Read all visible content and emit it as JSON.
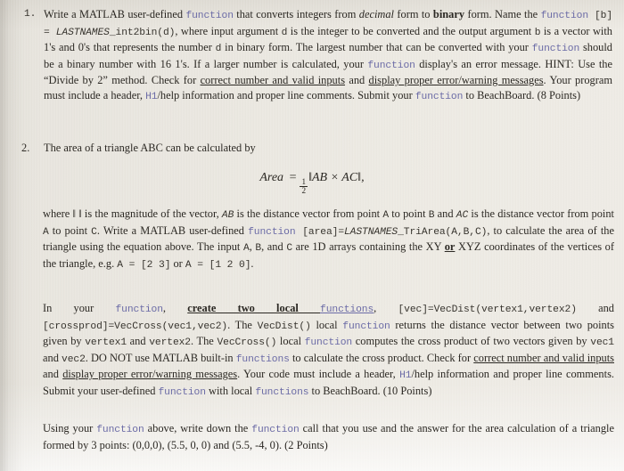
{
  "document": {
    "type": "homework-assignment-scan",
    "paper_color": "#e9e6df",
    "text_color": "#2b2823",
    "code_color": "#6b6ba6"
  },
  "questions": [
    {
      "number": "1.",
      "points": "(8 Points)",
      "segments": [
        {
          "t": "Write a MATLAB user-defined ",
          "s": "plain"
        },
        {
          "t": "function",
          "s": "code"
        },
        {
          "t": " that converts integers from ",
          "s": "plain"
        },
        {
          "t": "decimal",
          "s": "italic"
        },
        {
          "t": " form to ",
          "s": "plain"
        },
        {
          "t": "binary",
          "s": "bold"
        },
        {
          "t": " form. Name the ",
          "s": "plain"
        },
        {
          "t": "function",
          "s": "code"
        },
        {
          "t": " [b] = ",
          "s": "mono-dark"
        },
        {
          "t": "LASTNAMES",
          "s": "mono-ital"
        },
        {
          "t": "_int2bin(d)",
          "s": "mono-dark"
        },
        {
          "t": ", where input argument ",
          "s": "plain"
        },
        {
          "t": "d",
          "s": "mono-dark"
        },
        {
          "t": " is the integer to be converted and the output argument ",
          "s": "plain"
        },
        {
          "t": "b",
          "s": "mono-dark"
        },
        {
          "t": " is a vector with 1's and 0's that represents the number ",
          "s": "plain"
        },
        {
          "t": "d",
          "s": "mono-dark"
        },
        {
          "t": " in binary form. The largest number that can be converted with your ",
          "s": "plain"
        },
        {
          "t": "function",
          "s": "code"
        },
        {
          "t": " should be a binary number with 16 1's.  If a larger number is calculated, your ",
          "s": "plain"
        },
        {
          "t": "function",
          "s": "code"
        },
        {
          "t": " display's an error message. HINT: Use the “Divide by 2” method. Check for ",
          "s": "plain"
        },
        {
          "t": "correct number and valid inputs",
          "s": "underline"
        },
        {
          "t": " and ",
          "s": "plain"
        },
        {
          "t": "display proper error/warning messages",
          "s": "underline"
        },
        {
          "t": ". Your program must include a header, ",
          "s": "plain"
        },
        {
          "t": "H1",
          "s": "code"
        },
        {
          "t": "/help information and proper line comments.  Submit your ",
          "s": "plain"
        },
        {
          "t": "function",
          "s": "code"
        },
        {
          "t": " to BeachBoard. (8 Points)",
          "s": "plain"
        }
      ]
    },
    {
      "number": "2.",
      "points": "(10 Points)",
      "intro": "The area of a triangle ABC can be calculated by",
      "equation": {
        "lhs": "Area",
        "eq": "=",
        "frac_num": "1",
        "frac_den": "2",
        "rhs": "‖AB × AC‖,"
      },
      "body_segments": [
        {
          "t": "where ‖ ‖ is the magnitude of the vector, ",
          "s": "plain"
        },
        {
          "t": "AB",
          "s": "mono-ital"
        },
        {
          "t": " is the distance vector from point ",
          "s": "plain"
        },
        {
          "t": "A",
          "s": "mono-dark"
        },
        {
          "t": " to point ",
          "s": "plain"
        },
        {
          "t": "B",
          "s": "mono-dark"
        },
        {
          "t": " and ",
          "s": "plain"
        },
        {
          "t": "AC",
          "s": "mono-ital"
        },
        {
          "t": " is the distance vector from point ",
          "s": "plain"
        },
        {
          "t": "A",
          "s": "mono-dark"
        },
        {
          "t": " to point ",
          "s": "plain"
        },
        {
          "t": "C",
          "s": "mono-dark"
        },
        {
          "t": ". Write a MATLAB user-defined ",
          "s": "plain"
        },
        {
          "t": "function",
          "s": "code"
        },
        {
          "t": " [area]=",
          "s": "mono-dark"
        },
        {
          "t": "LASTNAMES",
          "s": "mono-ital"
        },
        {
          "t": "_TriArea(A,B,C)",
          "s": "mono-dark"
        },
        {
          "t": ", to calculate the area of the triangle using the equation above. The input ",
          "s": "plain"
        },
        {
          "t": "A",
          "s": "mono-dark"
        },
        {
          "t": ", ",
          "s": "plain"
        },
        {
          "t": "B",
          "s": "mono-dark"
        },
        {
          "t": ", and ",
          "s": "plain"
        },
        {
          "t": "C",
          "s": "mono-dark"
        },
        {
          "t": " are 1D arrays containing the XY ",
          "s": "plain"
        },
        {
          "t": "or",
          "s": "bold-underline"
        },
        {
          "t": " XYZ coordinates of the vertices of the triangle, e.g. ",
          "s": "plain"
        },
        {
          "t": "A = [2 3]",
          "s": "mono-dark"
        },
        {
          "t": " or ",
          "s": "plain"
        },
        {
          "t": "A = [1 2 0]",
          "s": "mono-dark"
        },
        {
          "t": ".",
          "s": "plain"
        }
      ],
      "body2_segments": [
        {
          "t": "In your ",
          "s": "plain"
        },
        {
          "t": "function",
          "s": "code"
        },
        {
          "t": ", ",
          "s": "plain"
        },
        {
          "t": "create two local ",
          "s": "bold-underline"
        },
        {
          "t": "functions",
          "s": "code-underline"
        },
        {
          "t": ", ",
          "s": "plain"
        },
        {
          "t": "[vec]=VecDist(vertex1,vertex2)",
          "s": "mono-dark"
        },
        {
          "t": " and ",
          "s": "plain"
        },
        {
          "t": "[crossprod]=VecCross(vec1,vec2)",
          "s": "mono-dark"
        },
        {
          "t": ". The ",
          "s": "plain"
        },
        {
          "t": "VecDist()",
          "s": "mono-dark"
        },
        {
          "t": " local ",
          "s": "plain"
        },
        {
          "t": "function",
          "s": "code"
        },
        {
          "t": " returns the distance vector between two points given by ",
          "s": "plain"
        },
        {
          "t": "vertex1",
          "s": "mono-dark"
        },
        {
          "t": " and ",
          "s": "plain"
        },
        {
          "t": "vertex2",
          "s": "mono-dark"
        },
        {
          "t": ". The ",
          "s": "plain"
        },
        {
          "t": "VecCross()",
          "s": "mono-dark"
        },
        {
          "t": " local ",
          "s": "plain"
        },
        {
          "t": "function",
          "s": "code"
        },
        {
          "t": " computes the cross product of two vectors given by ",
          "s": "plain"
        },
        {
          "t": "vec1",
          "s": "mono-dark"
        },
        {
          "t": " and ",
          "s": "plain"
        },
        {
          "t": "vec2",
          "s": "mono-dark"
        },
        {
          "t": ". DO NOT use MATLAB built-in ",
          "s": "plain"
        },
        {
          "t": "functions",
          "s": "code"
        },
        {
          "t": " to calculate the cross product. Check for ",
          "s": "plain"
        },
        {
          "t": "correct number and valid inputs",
          "s": "underline"
        },
        {
          "t": " and ",
          "s": "plain"
        },
        {
          "t": "display proper error/warning messages",
          "s": "underline"
        },
        {
          "t": ". Your code must include a header, ",
          "s": "plain"
        },
        {
          "t": "H1",
          "s": "code"
        },
        {
          "t": "/help information and proper line comments.  Submit your user-defined ",
          "s": "plain"
        },
        {
          "t": "function",
          "s": "code"
        },
        {
          "t": " with local ",
          "s": "plain"
        },
        {
          "t": "functions",
          "s": "code"
        },
        {
          "t": " to BeachBoard. (10 Points)",
          "s": "plain"
        }
      ]
    }
  ],
  "final_paragraph": {
    "points": "(2 Points)",
    "segments": [
      {
        "t": "Using your ",
        "s": "plain"
      },
      {
        "t": "function",
        "s": "code"
      },
      {
        "t": " above, write down the ",
        "s": "plain"
      },
      {
        "t": "function",
        "s": "code"
      },
      {
        "t": " call that you use and the answer for the area calculation of a triangle formed by 3 points: (0,0,0), (5.5, 0, 0) and (5.5, -4, 0).  (2 Points)",
        "s": "plain"
      }
    ]
  }
}
